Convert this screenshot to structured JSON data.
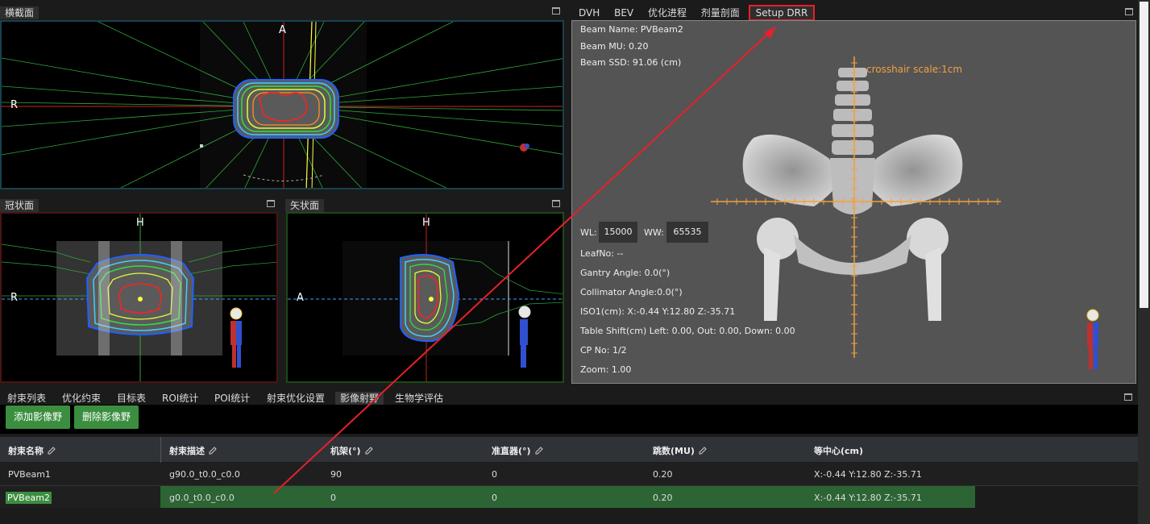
{
  "views": {
    "axial": {
      "title": "横截面",
      "label_a": "A",
      "label_r": "R"
    },
    "coronal": {
      "title": "冠状面",
      "label_h": "H",
      "label_r": "R"
    },
    "sagittal": {
      "title": "矢状面",
      "label_h": "H",
      "label_a": "A"
    }
  },
  "right_tabs": [
    "DVH",
    "BEV",
    "优化进程",
    "剂量剖面",
    "Setup DRR"
  ],
  "drr": {
    "beam_name": "Beam Name: PVBeam2",
    "beam_mu": "Beam MU: 0.20",
    "beam_ssd": "Beam SSD: 91.06 (cm)",
    "crosshair": "crosshair scale:1cm",
    "wl_label": "WL:",
    "wl_value": "15000",
    "ww_label": "WW:",
    "ww_value": "65535",
    "leaf_no": "LeafNo: --",
    "gantry": "Gantry Angle: 0.0(°)",
    "collimator": "Collimator Angle:0.0(°)",
    "iso": "ISO1(cm): X:-0.44 Y:12.80 Z:-35.71",
    "table_shift": "Table Shift(cm) Left: 0.00, Out: 0.00, Down: 0.00",
    "cp": "CP No: 1/2",
    "zoom": "Zoom: 1.00"
  },
  "bottom_tabs": [
    "射束列表",
    "优化约束",
    "目标表",
    "ROI统计",
    "POI统计",
    "射束优化设置",
    "影像射野",
    "生物学评估"
  ],
  "buttons": {
    "add": "添加影像野",
    "delete": "删除影像野"
  },
  "table": {
    "headers": [
      "射束名称",
      "射束描述",
      "机架(°)",
      "准直器(°)",
      "跳数(MU)",
      "等中心(cm)"
    ],
    "rows": [
      [
        "PVBeam1",
        "g90.0_t0.0_c0.0",
        "90",
        "0",
        "0.20",
        "X:-0.44 Y:12.80 Z:-35.71"
      ],
      [
        "PVBeam2",
        "g0.0_t0.0_c0.0",
        "0",
        "0",
        "0.20",
        "X:-0.44 Y:12.80 Z:-35.71"
      ]
    ]
  },
  "colors": {
    "accent_green": "#3b8e3f",
    "highlight_red": "#e8202a",
    "crosshair_orange": "#f0a040"
  }
}
